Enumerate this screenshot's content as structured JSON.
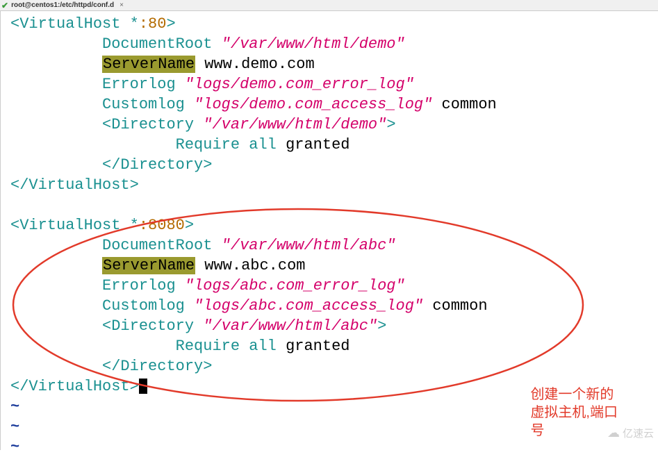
{
  "tab": {
    "label": "root@centos1:/etc/httpd/conf.d",
    "close": "×"
  },
  "vhost1": {
    "open_sp": " ",
    "open_tag": "<VirtualHost",
    "star": "*",
    "port": ":80",
    "close_bracket": ">",
    "docroot_kw": "DocumentRoot",
    "docroot_val": "\"/var/www/html/demo\"",
    "servername_kw": "ServerName",
    "servername_val": "www.demo.com",
    "errorlog_kw": "Errorlog",
    "errorlog_val": "\"logs/demo.com_error_log\"",
    "customlog_kw": "Customlog",
    "customlog_val": "\"logs/demo.com_access_log\"",
    "customlog_tail": "common",
    "dir_open": "<Directory",
    "dir_path": "\"/var/www/html/demo\"",
    "dir_close_bracket": ">",
    "require_kw": "Require",
    "require_all": "all",
    "require_granted": "granted",
    "dir_close": "</Directory>",
    "close_tag": "</VirtualHost>"
  },
  "vhost2": {
    "open_tag": "<VirtualHost",
    "star": "*",
    "port": ":8080",
    "close_bracket": ">",
    "docroot_kw": "DocumentRoot",
    "docroot_val": "\"/var/www/html/abc\"",
    "servername_kw": "ServerName",
    "servername_val": "www.abc.com",
    "errorlog_kw": "Errorlog",
    "errorlog_val": "\"logs/abc.com_error_log\"",
    "customlog_kw": "Customlog",
    "customlog_val": "\"logs/abc.com_access_log\"",
    "customlog_tail": "common",
    "dir_open": "<Directory",
    "dir_path": "\"/var/www/html/abc\"",
    "dir_close_bracket": ">",
    "require_kw": "Require",
    "require_all": "all",
    "require_granted": "granted",
    "dir_close": "</Directory>",
    "close_tag": "</VirtualHost>"
  },
  "tilde": "~",
  "annotation": {
    "line1": "创建一个新的",
    "line2": "虚拟主机,端口",
    "line3": "号"
  },
  "watermark": "亿速云"
}
